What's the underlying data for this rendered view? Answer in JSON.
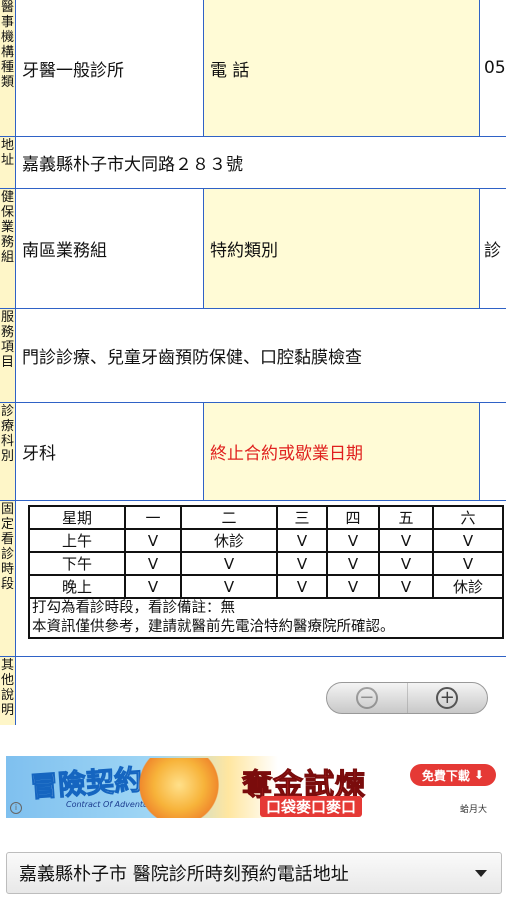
{
  "left_labels": [
    "醫事機構種類",
    "地址",
    "健保業務組",
    "服務項目",
    "診療科別",
    "固定看診時段",
    "其他說明"
  ],
  "rows": {
    "type_value": "牙醫一般診所",
    "phone_label": "電 話",
    "phone_value": "05",
    "address_value": "嘉義縣朴子市大同路２８３號",
    "region_value": "南區業務組",
    "contract_label": "特約類別",
    "contract_value": "診",
    "services_value": "門診診療、兒童牙齒預防保健、口腔黏膜檢查",
    "dept_value": "牙科",
    "terminate_label": "終止合約或歇業日期"
  },
  "schedule": {
    "header": [
      "星期",
      "一",
      "二",
      "三",
      "四",
      "五",
      "六"
    ],
    "rows": [
      [
        "上午",
        "V",
        "休診",
        "V",
        "V",
        "V",
        "V"
      ],
      [
        "下午",
        "V",
        "V",
        "V",
        "V",
        "V",
        "V"
      ],
      [
        "晚上",
        "V",
        "V",
        "V",
        "V",
        "V",
        "休診"
      ]
    ],
    "note1": "打勾為看診時段，看診備註：無",
    "note2": "本資訊僅供參考，建請就醫前先電洽特約醫療院所確認。"
  },
  "zoom": {
    "out_icon": "zoom-out-icon",
    "in_icon": "zoom-in-icon"
  },
  "ad": {
    "logo": "冒險契約",
    "logo_sub": "Contract Of Adventure",
    "headline": "奪金試煉",
    "sub": "口袋麥口麥口",
    "download": "免費下載",
    "tiny": "蛤月大"
  },
  "select": {
    "value": "嘉義縣朴子市 醫院診所時刻預約電話地址"
  },
  "colors": {
    "grid_blue": "#2f62c6",
    "cell_yellow": "#fffbd6",
    "alert_red": "#e0201e"
  }
}
